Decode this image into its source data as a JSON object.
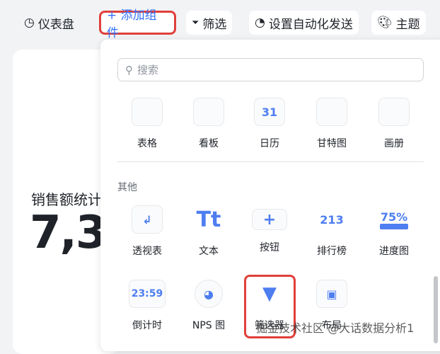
{
  "toolbar": {
    "dashboard": "仪表盘",
    "add_widget": "+ 添加组件",
    "filter": "筛选",
    "auto_send": "设置自动化发送",
    "theme": "主题"
  },
  "card": {
    "title": "销售额统计",
    "value": "7,3"
  },
  "panel": {
    "search_placeholder": "搜索",
    "views": [
      {
        "label": "表格"
      },
      {
        "label": "看板"
      },
      {
        "label": "日历",
        "icon_text": "31"
      },
      {
        "label": "甘特图"
      },
      {
        "label": "画册"
      }
    ],
    "other_title": "其他",
    "other": [
      {
        "label": "透视表"
      },
      {
        "label": "文本",
        "icon_text": "Tt"
      },
      {
        "label": "按钮",
        "icon_text": "+"
      },
      {
        "label": "排行榜",
        "icon_text": "213"
      },
      {
        "label": "进度图",
        "icon_text": "75%"
      },
      {
        "label": "倒计时",
        "icon_text": "23:59"
      },
      {
        "label": "NPS 图"
      },
      {
        "label": "筛选器"
      },
      {
        "label": "布局"
      }
    ]
  },
  "watermark": "掘金技术社区 @大话数据分析1"
}
